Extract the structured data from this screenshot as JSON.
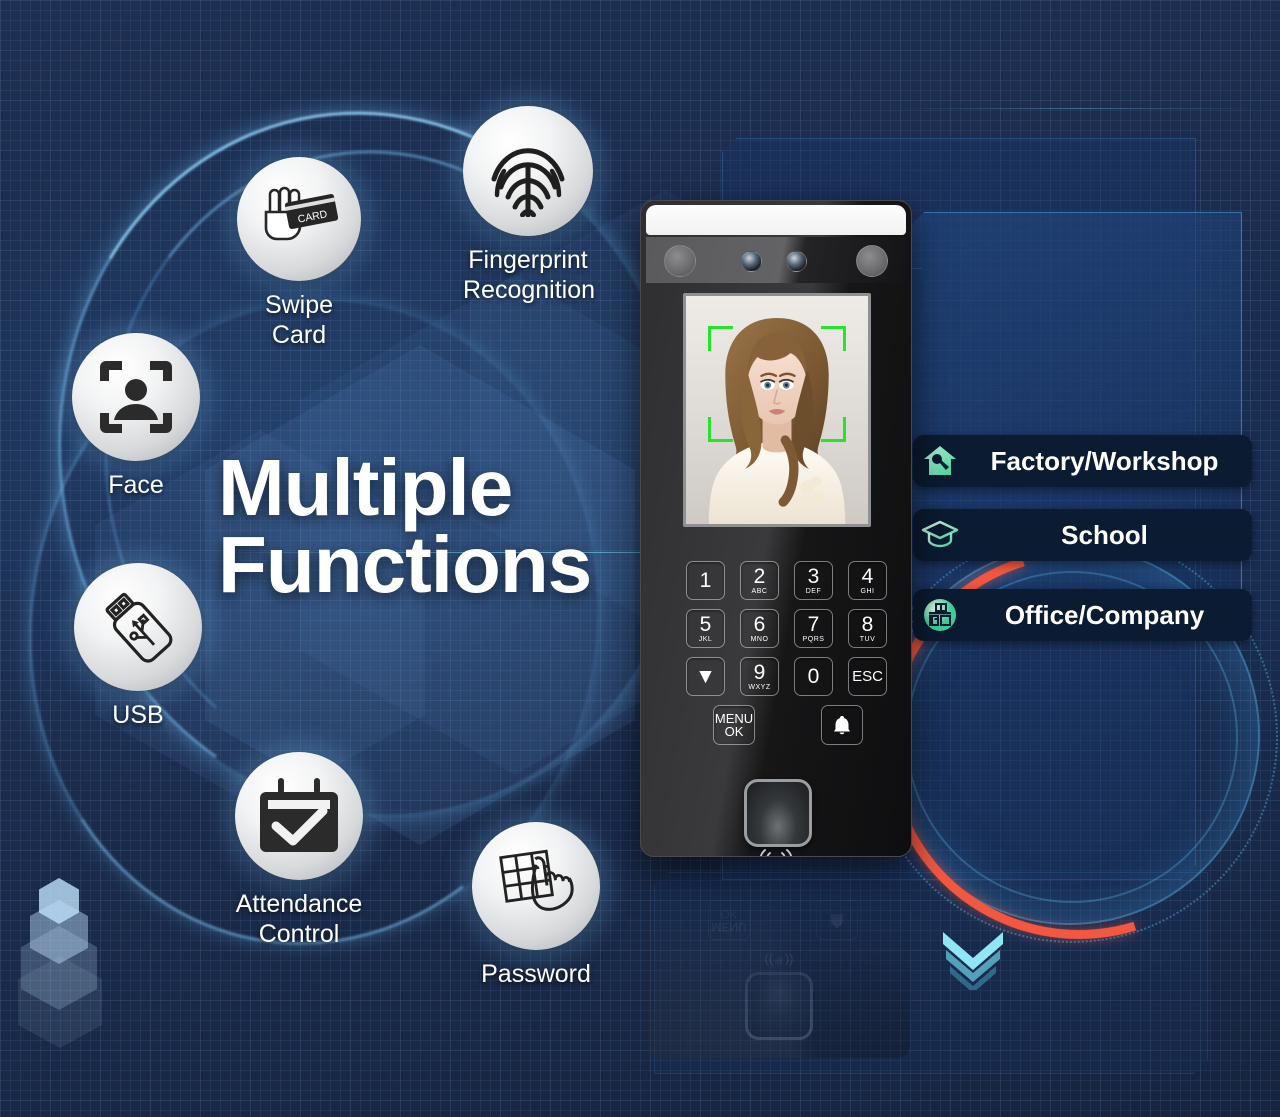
{
  "headline": {
    "line1": "Multiple",
    "line2": "Functions"
  },
  "features": [
    {
      "id": "swipe-card",
      "icon": "swipe-card-icon",
      "label": "Swipe\nCard",
      "card_text": "CARD"
    },
    {
      "id": "fingerprint",
      "icon": "fingerprint-icon",
      "label": "Fingerprint\nRecognition"
    },
    {
      "id": "face",
      "icon": "face-recognition-icon",
      "label": "Face"
    },
    {
      "id": "usb",
      "icon": "usb-drive-icon",
      "label": "USB"
    },
    {
      "id": "attendance",
      "icon": "calendar-check-icon",
      "label": "Attendance\nControl"
    },
    {
      "id": "password",
      "icon": "keypad-hand-icon",
      "label": "Password"
    }
  ],
  "scenarios": [
    {
      "id": "factory",
      "icon": "house-wrench-icon",
      "label": "Factory/Workshop"
    },
    {
      "id": "school",
      "icon": "graduation-cap-icon",
      "label": "School"
    },
    {
      "id": "office",
      "icon": "office-desk-icon",
      "label": "Office/Company"
    }
  ],
  "device": {
    "name": "face-recognition-terminal",
    "screen_subject": "portrait of a woman with face detection brackets",
    "keypad_rows": [
      [
        {
          "num": "1",
          "sub": ""
        },
        {
          "num": "2",
          "sub": "ABC"
        },
        {
          "num": "3",
          "sub": "DEF"
        },
        {
          "num": "4",
          "sub": "GHI"
        }
      ],
      [
        {
          "num": "5",
          "sub": "JKL"
        },
        {
          "num": "6",
          "sub": "MNO"
        },
        {
          "num": "7",
          "sub": "PQRS"
        },
        {
          "num": "8",
          "sub": "TUV"
        }
      ],
      [
        {
          "num": "▼",
          "sub": ""
        },
        {
          "num": "9",
          "sub": "WXYZ"
        },
        {
          "num": "0",
          "sub": ""
        },
        {
          "num": "ESC",
          "sub": ""
        }
      ]
    ],
    "menu_key": {
      "line1": "MENU",
      "line2": "OK"
    },
    "bell_key_icon": "bell-icon",
    "fingerprint_sensor_icon": "fingerprint-sensor",
    "rfid_icon": "rfid-wave-icon"
  },
  "decor": {
    "chevrons_icon": "triple-down-chevron-icon",
    "hex_stack_icon": "hexagon-stack-icon"
  },
  "colors": {
    "background": "#1d2f52",
    "accent_cyan": "#78d7f5",
    "accent_red": "#f4573f",
    "pill_bg": "#0b1b31",
    "pill_icon_green": "#7fe3b6",
    "detect_green": "#25e52a",
    "text_white": "#ffffff"
  }
}
